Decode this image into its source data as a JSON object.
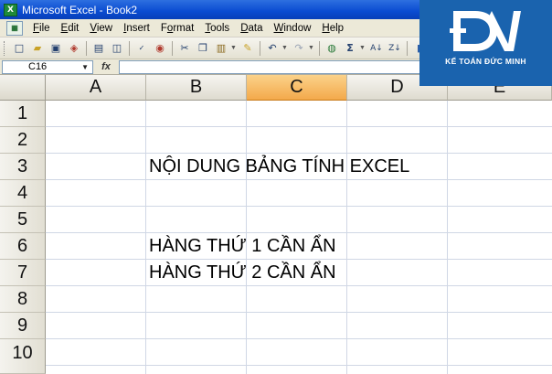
{
  "window": {
    "title": "Microsoft Excel - Book2",
    "app_icon": "excel-icon"
  },
  "menu": {
    "items": [
      {
        "label": "File",
        "hotkey": "F"
      },
      {
        "label": "Edit",
        "hotkey": "E"
      },
      {
        "label": "View",
        "hotkey": "V"
      },
      {
        "label": "Insert",
        "hotkey": "I"
      },
      {
        "label": "Format",
        "hotkey": "o"
      },
      {
        "label": "Tools",
        "hotkey": "T"
      },
      {
        "label": "Data",
        "hotkey": "D"
      },
      {
        "label": "Window",
        "hotkey": "W"
      },
      {
        "label": "Help",
        "hotkey": "H"
      }
    ]
  },
  "toolbar": {
    "buttons": [
      "new-icon",
      "open-icon",
      "save-icon",
      "permission-icon",
      "print-icon",
      "print-preview-icon",
      "spelling-icon",
      "research-icon",
      "cut-icon",
      "copy-icon",
      "paste-icon",
      "format-painter-icon",
      "undo-icon",
      "redo-icon",
      "hyperlink-icon",
      "autosum-icon",
      "sort-ascending-icon",
      "sort-descending-icon",
      "chart-wizard-icon"
    ]
  },
  "formula_bar": {
    "name_box": "C16",
    "fx_label": "fx",
    "value": ""
  },
  "grid": {
    "columns": [
      "A",
      "B",
      "C",
      "D",
      "E"
    ],
    "active_column": "C",
    "rows": [
      "1",
      "2",
      "3",
      "4",
      "5",
      "6",
      "7",
      "8",
      "9",
      "10"
    ],
    "cells": {
      "B3": "NỘI DUNG BẢNG TÍNH EXCEL",
      "B6": "HÀNG THỨ 1 CẦN ẨN",
      "B7": "HÀNG THỨ 2 CẦN ẨN"
    }
  },
  "logo": {
    "text": "KẾ TOÁN ĐỨC MINH",
    "color": "#1a63ae"
  },
  "colors": {
    "titlebar": "#0a4bd1",
    "active_header": "#f3a94b",
    "gridline": "#d0d7e5"
  }
}
